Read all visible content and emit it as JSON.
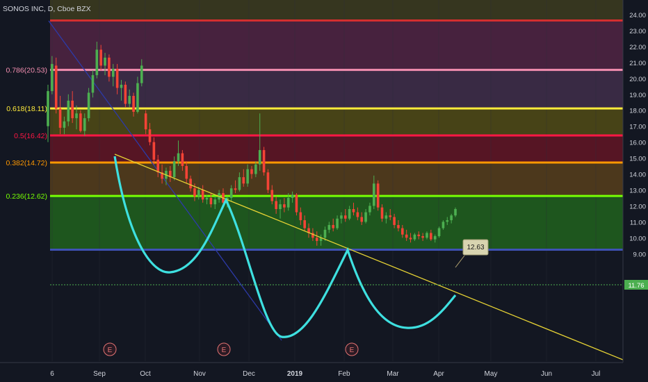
{
  "header": {
    "title": "SONOS INC, D, Cboe BZX"
  },
  "colors": {
    "background": "#131722",
    "axis_text": "#d1d4dc",
    "up_candle": "#26a69a",
    "down_candle": "#ef5350",
    "pattern_curve": "#3ee0e0",
    "resistance_line": "#e6d234",
    "descending_line": "#2d3aa8"
  },
  "chart_data": {
    "type": "candlestick",
    "title": "SONOS INC, D, Cboe BZX",
    "ylim": [
      8.5,
      24.5
    ],
    "y_ticks": [
      "24.00",
      "23.00",
      "22.00",
      "21.00",
      "20.00",
      "19.00",
      "18.00",
      "17.00",
      "16.00",
      "15.00",
      "14.00",
      "13.00",
      "12.00",
      "11.00",
      "10.00",
      "9.00"
    ],
    "x_ticks": [
      "6",
      "Sep",
      "Oct",
      "Nov",
      "Dec",
      "2019",
      "Feb",
      "Mar",
      "Apr",
      "May",
      "Jun",
      "Jul"
    ],
    "fib_levels": [
      {
        "label": "",
        "price": 23.63,
        "color": "#d32f2f",
        "band": "#5a1a24"
      },
      {
        "label": "0.786(20.53)",
        "price": 20.53,
        "color": "#f48fb1",
        "band": "#4a2340"
      },
      {
        "label": "0.618(18.11)",
        "price": 18.11,
        "color": "#ffeb3b",
        "band": "#3b2b47"
      },
      {
        "label": "0.5(16.42)",
        "price": 16.42,
        "color": "#ff1744",
        "band": "#4a4617"
      },
      {
        "label": "0.382(14.72)",
        "price": 14.72,
        "color": "#ff9800",
        "band": "#5a1525"
      },
      {
        "label": "0.236(12.62)",
        "price": 12.62,
        "color": "#76ff03",
        "band": "#4f3a1c"
      },
      {
        "label": "",
        "price": 9.25,
        "color": "#3f51b5",
        "band": "#1f5a1f"
      }
    ],
    "price_callout": "12.63",
    "last_price": "11.76",
    "earnings_markers": [
      "E",
      "E",
      "E"
    ],
    "candles": [
      [
        1,
        17.0,
        19.6,
        16.0,
        19.2
      ],
      [
        2,
        19.2,
        21.4,
        19.0,
        20.9
      ],
      [
        3,
        20.8,
        21.3,
        17.8,
        18.1
      ],
      [
        4,
        18.1,
        18.9,
        16.5,
        16.9
      ],
      [
        5,
        16.9,
        17.6,
        16.5,
        17.3
      ],
      [
        6,
        17.3,
        19.0,
        17.0,
        18.6
      ],
      [
        7,
        18.6,
        19.2,
        17.2,
        17.5
      ],
      [
        8,
        17.5,
        18.3,
        16.8,
        17.8
      ],
      [
        9,
        17.8,
        18.0,
        16.6,
        16.7
      ],
      [
        10,
        16.7,
        17.8,
        16.4,
        17.5
      ],
      [
        11,
        17.5,
        19.4,
        17.3,
        19.1
      ],
      [
        12,
        19.1,
        20.5,
        18.8,
        20.2
      ],
      [
        13,
        20.2,
        22.3,
        20.0,
        21.8
      ],
      [
        14,
        21.8,
        22.1,
        20.5,
        20.8
      ],
      [
        15,
        20.8,
        21.6,
        20.2,
        21.3
      ],
      [
        16,
        21.3,
        21.5,
        19.8,
        20.1
      ],
      [
        17,
        20.1,
        20.9,
        19.5,
        20.6
      ],
      [
        18,
        20.6,
        20.9,
        19.0,
        19.4
      ],
      [
        19,
        19.4,
        19.9,
        18.6,
        19.6
      ],
      [
        20,
        19.6,
        19.8,
        18.2,
        18.4
      ],
      [
        21,
        18.4,
        19.3,
        18.2,
        18.9
      ],
      [
        22,
        18.9,
        19.1,
        17.6,
        17.9
      ],
      [
        23,
        17.9,
        20.1,
        17.8,
        19.7
      ],
      [
        24,
        19.7,
        21.2,
        19.5,
        20.8
      ],
      [
        25,
        17.8,
        18.0,
        16.5,
        16.8
      ],
      [
        26,
        16.8,
        17.2,
        15.8,
        16.0
      ],
      [
        27,
        16.0,
        16.3,
        14.6,
        14.9
      ],
      [
        28,
        14.9,
        15.2,
        13.8,
        14.1
      ],
      [
        29,
        14.1,
        14.6,
        13.4,
        13.7
      ],
      [
        30,
        13.7,
        14.4,
        13.3,
        14.2
      ],
      [
        31,
        14.2,
        14.5,
        13.5,
        13.8
      ],
      [
        32,
        13.8,
        15.1,
        13.6,
        14.8
      ],
      [
        33,
        14.8,
        16.1,
        14.5,
        15.3
      ],
      [
        34,
        15.3,
        15.5,
        14.2,
        14.5
      ],
      [
        35,
        14.5,
        14.8,
        13.4,
        13.7
      ],
      [
        36,
        13.7,
        13.9,
        12.9,
        13.1
      ],
      [
        37,
        13.1,
        13.4,
        12.3,
        12.6
      ],
      [
        38,
        12.6,
        13.2,
        12.4,
        13.0
      ],
      [
        39,
        13.0,
        13.3,
        12.2,
        12.4
      ],
      [
        40,
        12.4,
        12.7,
        12.1,
        12.5
      ],
      [
        41,
        12.5,
        12.8,
        11.9,
        12.1
      ],
      [
        42,
        12.1,
        12.6,
        11.8,
        12.4
      ],
      [
        43,
        12.4,
        13.0,
        12.2,
        12.8
      ],
      [
        44,
        12.8,
        13.1,
        12.0,
        12.2
      ],
      [
        45,
        12.2,
        12.6,
        11.9,
        12.5
      ],
      [
        46,
        12.5,
        13.3,
        12.3,
        13.1
      ],
      [
        47,
        13.1,
        13.6,
        12.8,
        13.0
      ],
      [
        48,
        13.0,
        14.1,
        12.9,
        13.8
      ],
      [
        49,
        13.8,
        14.3,
        13.2,
        13.4
      ],
      [
        50,
        13.4,
        14.6,
        13.2,
        14.3
      ],
      [
        51,
        14.3,
        14.5,
        13.7,
        14.0
      ],
      [
        52,
        14.0,
        14.8,
        13.8,
        14.6
      ],
      [
        53,
        14.6,
        17.8,
        14.2,
        15.5
      ],
      [
        54,
        15.5,
        15.7,
        13.9,
        14.1
      ],
      [
        55,
        14.1,
        14.3,
        12.8,
        13.0
      ],
      [
        56,
        13.0,
        13.3,
        12.1,
        12.3
      ],
      [
        57,
        12.3,
        12.6,
        11.5,
        11.8
      ],
      [
        58,
        11.8,
        12.4,
        11.2,
        12.1
      ],
      [
        59,
        12.1,
        12.5,
        11.6,
        11.9
      ],
      [
        60,
        11.9,
        12.8,
        11.7,
        12.5
      ],
      [
        61,
        12.5,
        12.9,
        12.2,
        12.7
      ],
      [
        62,
        12.7,
        12.8,
        11.4,
        11.6
      ],
      [
        63,
        11.6,
        11.9,
        10.8,
        11.1
      ],
      [
        64,
        11.1,
        11.4,
        10.4,
        10.6
      ],
      [
        65,
        10.6,
        10.9,
        10.0,
        10.3
      ],
      [
        66,
        10.3,
        10.6,
        9.8,
        10.0
      ],
      [
        67,
        10.0,
        10.4,
        9.5,
        9.8
      ],
      [
        68,
        9.8,
        10.2,
        9.5,
        10.0
      ],
      [
        69,
        10.0,
        10.7,
        9.8,
        10.5
      ],
      [
        70,
        10.5,
        11.0,
        10.3,
        10.8
      ],
      [
        71,
        10.8,
        11.2,
        10.4,
        10.6
      ],
      [
        72,
        10.6,
        11.4,
        10.5,
        11.2
      ],
      [
        73,
        11.2,
        11.6,
        10.9,
        11.4
      ],
      [
        74,
        11.4,
        11.8,
        11.0,
        11.2
      ],
      [
        75,
        11.2,
        12.0,
        11.1,
        11.8
      ],
      [
        76,
        11.8,
        12.2,
        11.4,
        11.6
      ],
      [
        77,
        11.6,
        11.9,
        11.1,
        11.3
      ],
      [
        78,
        11.3,
        11.6,
        10.8,
        11.0
      ],
      [
        79,
        11.0,
        11.8,
        10.9,
        11.6
      ],
      [
        80,
        11.6,
        12.2,
        11.4,
        12.0
      ],
      [
        81,
        12.0,
        13.9,
        11.8,
        13.4
      ],
      [
        82,
        13.4,
        13.6,
        11.7,
        11.9
      ],
      [
        83,
        11.9,
        12.1,
        11.0,
        11.2
      ],
      [
        84,
        11.2,
        11.6,
        10.9,
        11.4
      ],
      [
        85,
        11.4,
        11.8,
        11.1,
        11.3
      ],
      [
        86,
        11.3,
        11.5,
        10.6,
        10.8
      ],
      [
        87,
        10.8,
        11.1,
        10.4,
        10.6
      ],
      [
        88,
        10.6,
        10.8,
        10.0,
        10.2
      ],
      [
        89,
        10.2,
        10.5,
        9.8,
        10.0
      ],
      [
        90,
        10.0,
        10.3,
        9.7,
        9.9
      ],
      [
        91,
        9.9,
        10.3,
        9.8,
        10.2
      ],
      [
        92,
        10.2,
        10.4,
        9.9,
        10.1
      ],
      [
        93,
        10.1,
        10.3,
        9.8,
        10.0
      ],
      [
        94,
        10.0,
        10.4,
        9.9,
        10.3
      ],
      [
        95,
        10.3,
        10.5,
        9.8,
        9.9
      ],
      [
        96,
        9.9,
        10.2,
        9.7,
        10.1
      ],
      [
        97,
        10.1,
        10.7,
        10.0,
        10.6
      ],
      [
        98,
        10.6,
        11.1,
        10.5,
        11.0
      ],
      [
        99,
        11.0,
        11.3,
        10.8,
        11.1
      ],
      [
        100,
        11.1,
        11.5,
        10.9,
        11.4
      ],
      [
        101,
        11.4,
        11.9,
        11.3,
        11.8
      ]
    ]
  }
}
